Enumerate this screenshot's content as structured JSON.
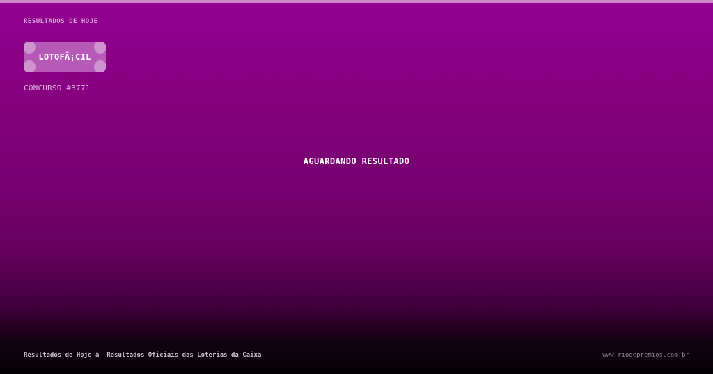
{
  "header": {
    "kicker": "RESULTADOS DE HOJE"
  },
  "lottery": {
    "name": "LOTOFÃ¡CIL",
    "contest": "CONCURSO #3771"
  },
  "main": {
    "status": "AGUARDANDO RESULTADO"
  },
  "footer": {
    "tagline": "Resultados de Hoje â  Resultados Oficiais das Loterias da Caixa",
    "site": "www.riodepremios.com.br"
  },
  "colors": {
    "top_bar": "#c88ac8",
    "background_top": "#930192",
    "background_bottom": "#050005",
    "badge": "#b759b6",
    "text_primary": "#ffffff"
  }
}
